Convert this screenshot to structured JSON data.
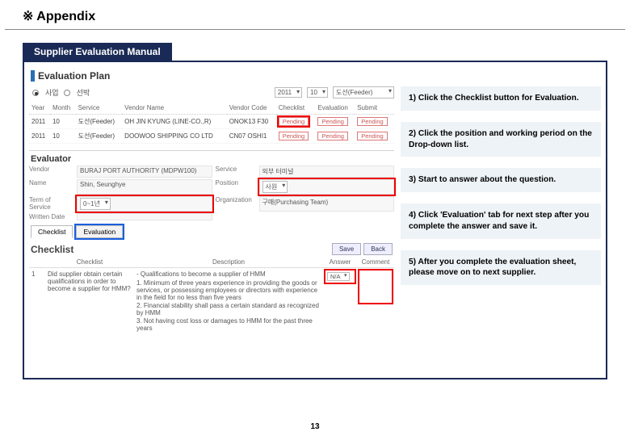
{
  "page": {
    "title": "※ Appendix",
    "subtitle": "Supplier Evaluation Manual",
    "number": "13"
  },
  "instructions": [
    "1) Click the Checklist button for Evaluation.",
    "2)  Click the position and  working period on the Drop-down list.",
    "3) Start to answer about the question.",
    "4) Click 'Evaluation' tab for next step after you complete the answer and save it.",
    "5) After you complete the evaluation sheet, please move on to next supplier."
  ],
  "shot": {
    "plan_title": "Evaluation Plan",
    "radio_a": "사업",
    "radio_b": "선박",
    "year_sel": "2011",
    "month_sel": "10",
    "filter_sel": "도선(Feeder)",
    "plan_cols": [
      "Year",
      "Month",
      "Service",
      "Vendor Name",
      "Vendor Code",
      "Checklist",
      "Evaluation",
      "Submit"
    ],
    "rows": [
      {
        "y": "2011",
        "m": "10",
        "svc": "도선(Feeder)",
        "vname": "OH JIN KYUNG (LINE-CO.,R)",
        "vcode": "ONOK13 F30",
        "c": "Pending",
        "e": "Pending",
        "s": "Pending"
      },
      {
        "y": "2011",
        "m": "10",
        "svc": "도선(Feeder)",
        "vname": "DOOWOO SHIPPING CO LTD",
        "vcode": "CN07 OSHI1",
        "c": "Pending",
        "e": "Pending",
        "s": "Pending"
      }
    ],
    "evaluator_title": "Evaluator",
    "evaluator": {
      "vendor_l": "Vendor",
      "vendor_v": "BURAJ PORT AUTHORITY (MDPW100)",
      "service_l": "Service",
      "service_v": "외부 터미널",
      "name_l": "Name",
      "name_v": "Shin, Seunghye",
      "pos_l": "Position",
      "pos_v": "사원",
      "term_l": "Term of Service",
      "term_v": "0~1년",
      "org_l": "Organization",
      "org_v": "구매(Purchasing Team)",
      "date_l": "Written Date",
      "date_v": ""
    },
    "tabs": {
      "checklist": "Checklist",
      "evaluation": "Evaluation"
    },
    "checklist_title": "Checklist",
    "btn_save": "Save",
    "btn_back": "Back",
    "check_cols": {
      "c": "Checklist",
      "d": "Description",
      "a": "Answer",
      "m": "Comment"
    },
    "q_no": "1",
    "q_text": "Did supplier obtain certain qualifications in order to become a supplier for HMM?",
    "desc_title": "- Qualifications to become a supplier of HMM",
    "desc_items": [
      "1. Minimum of three years experience in providing the goods or services, or possessing employees or directors with experience in the field for no less than five years",
      "2. Financial stability shall pass a certain standard as recognized by HMM",
      "3. Not having cost loss or damages to HMM for the past three years"
    ],
    "ans_val": "N/A"
  }
}
